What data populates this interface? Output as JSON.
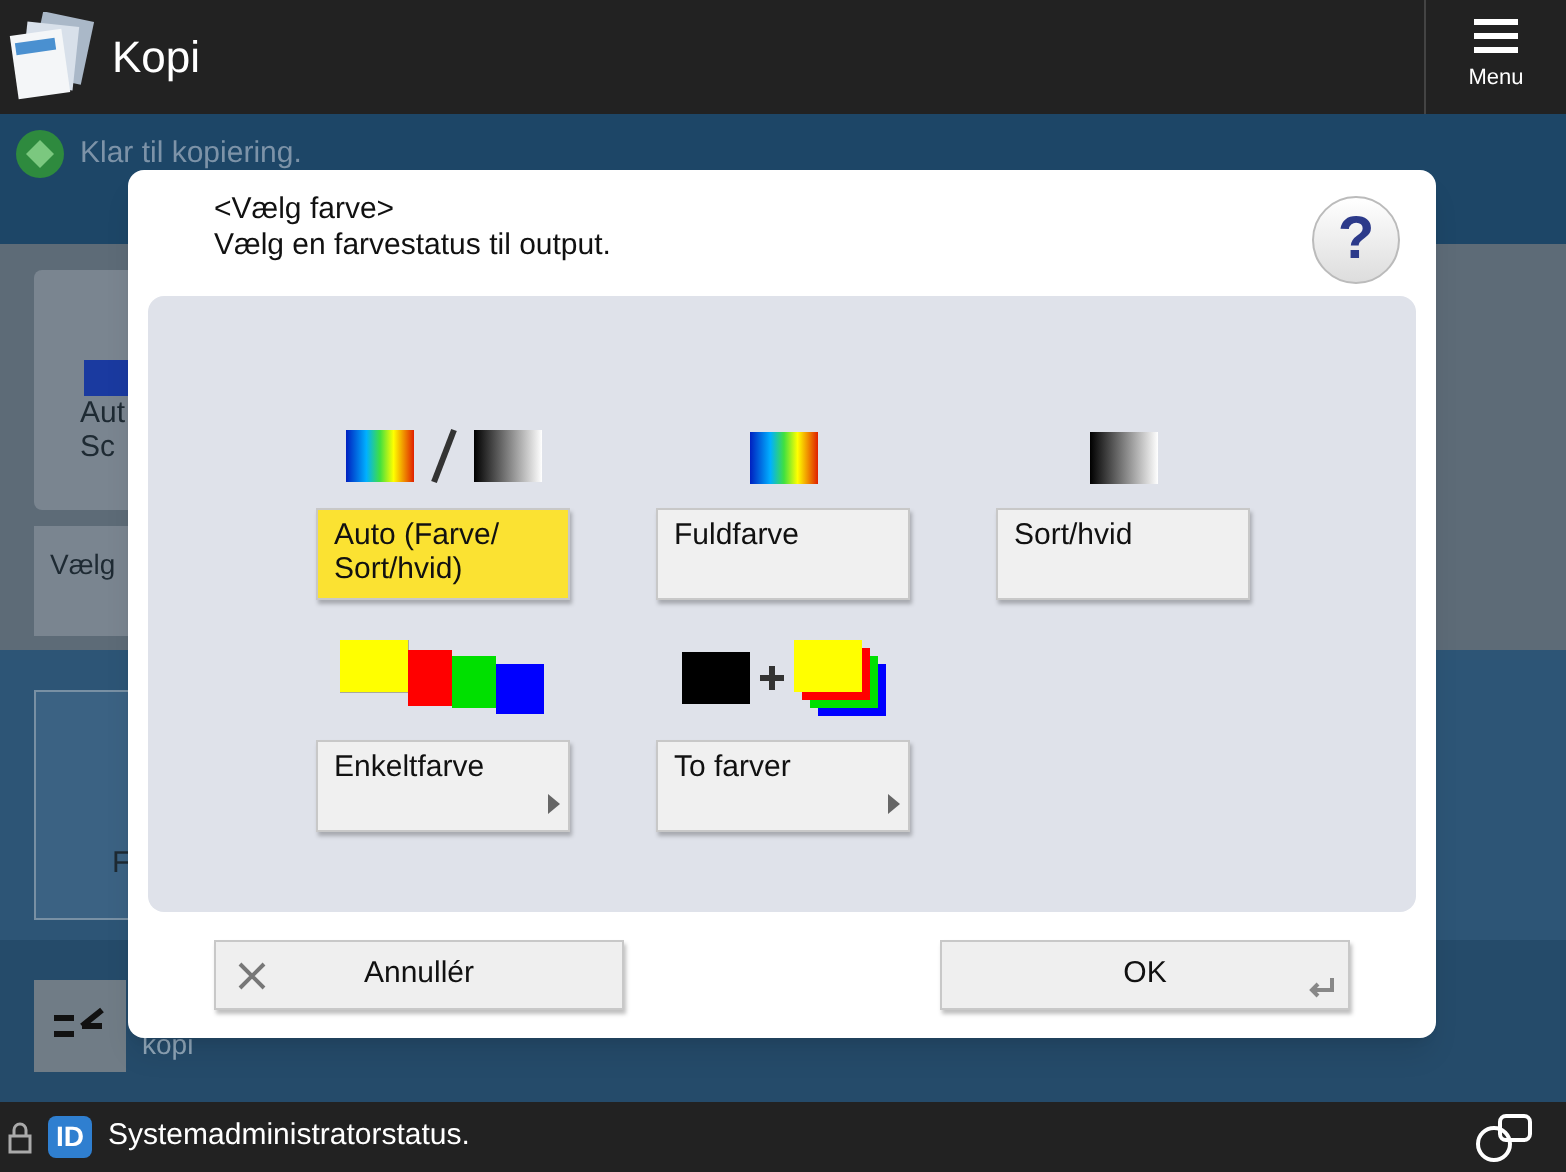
{
  "header": {
    "title": "Kopi",
    "menu_label": "Menu"
  },
  "status": {
    "text": "Klar til kopiering."
  },
  "background": {
    "tile_lines": [
      "Aut",
      "Sc"
    ],
    "row_label": "Vælg",
    "tile2_label": "F",
    "bottom_label": "kopi"
  },
  "dialog": {
    "title": "<Vælg farve>",
    "subtitle": "Vælg en farvestatus til output.",
    "help": "?",
    "options": [
      {
        "label": "Auto (Farve/ Sort/hvid)",
        "kind": "auto",
        "selected": true,
        "submenu": false
      },
      {
        "label": "Fuldfarve",
        "kind": "full",
        "selected": false,
        "submenu": false
      },
      {
        "label": "Sort/hvid",
        "kind": "bw",
        "selected": false,
        "submenu": false
      },
      {
        "label": "Enkeltfarve",
        "kind": "single",
        "selected": false,
        "submenu": true
      },
      {
        "label": "To farver",
        "kind": "two",
        "selected": false,
        "submenu": true
      }
    ],
    "cancel": "Annullér",
    "ok": "OK"
  },
  "footer": {
    "badge": "ID",
    "text": "Systemadministratorstatus."
  }
}
